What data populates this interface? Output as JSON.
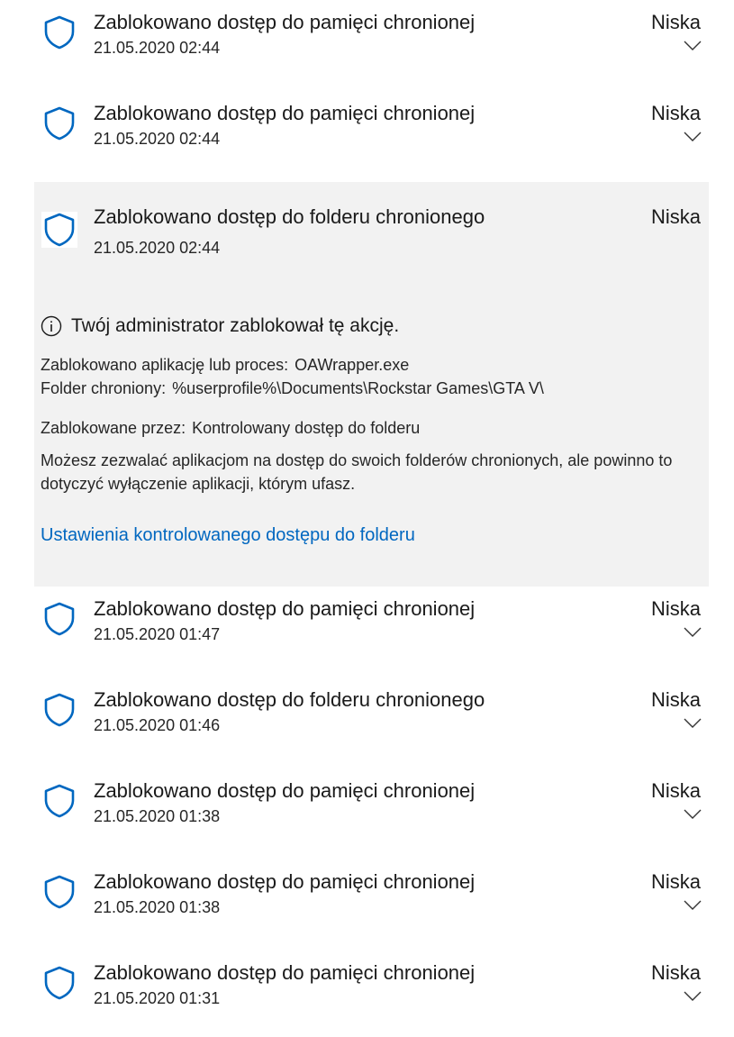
{
  "accent": "#0067c0",
  "items": [
    {
      "title": "Zablokowano dostęp do pamięci chronionej",
      "date": "21.05.2020 02:44",
      "severity": "Niska"
    },
    {
      "title": "Zablokowano dostęp do pamięci chronionej",
      "date": "21.05.2020 02:44",
      "severity": "Niska"
    },
    {
      "title": "Zablokowano dostęp do folderu chronionego",
      "date": "21.05.2020 02:44",
      "severity": "Niska",
      "details": {
        "notice": "Twój administrator zablokował tę akcję.",
        "app_label": "Zablokowano aplikację lub proces:",
        "app_value": "OAWrapper.exe",
        "folder_label": "Folder chroniony:",
        "folder_value": "%userprofile%\\Documents\\Rockstar Games\\GTA V\\",
        "blocked_by_label": "Zablokowane przez:",
        "blocked_by_value": "Kontrolowany dostęp do folderu",
        "description": "Możesz zezwalać aplikacjom na dostęp do swoich folderów chronionych, ale powinno to dotyczyć wyłączenie aplikacji, którym ufasz.",
        "link": "Ustawienia kontrolowanego dostępu do folderu"
      }
    },
    {
      "title": "Zablokowano dostęp do pamięci chronionej",
      "date": "21.05.2020 01:47",
      "severity": "Niska"
    },
    {
      "title": "Zablokowano dostęp do folderu chronionego",
      "date": "21.05.2020 01:46",
      "severity": "Niska"
    },
    {
      "title": "Zablokowano dostęp do pamięci chronionej",
      "date": "21.05.2020 01:38",
      "severity": "Niska"
    },
    {
      "title": "Zablokowano dostęp do pamięci chronionej",
      "date": "21.05.2020 01:38",
      "severity": "Niska"
    },
    {
      "title": "Zablokowano dostęp do pamięci chronionej",
      "date": "21.05.2020 01:31",
      "severity": "Niska"
    }
  ]
}
